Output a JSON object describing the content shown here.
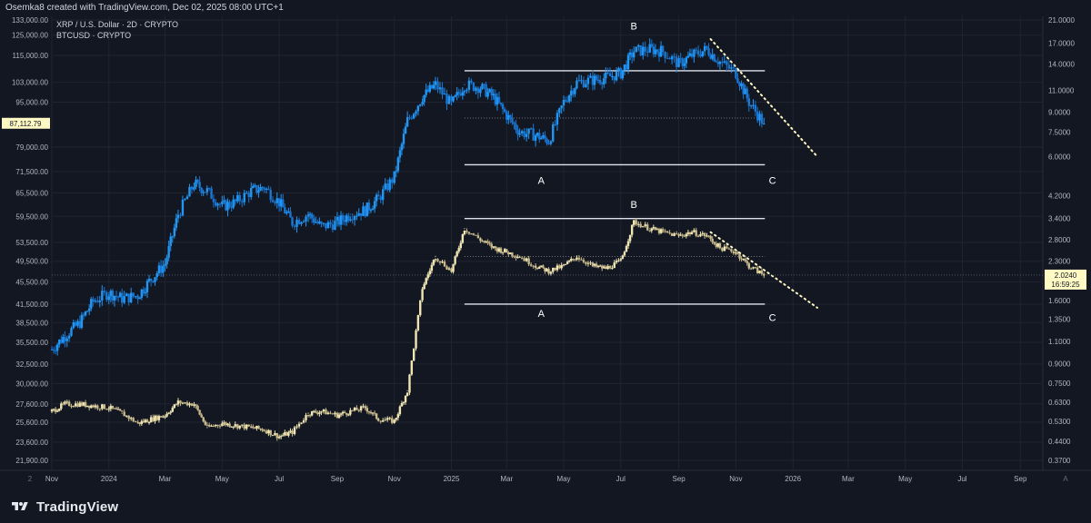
{
  "header": {
    "credit": "Osemka8 created with TradingView.com, Dec 02, 2025 08:00 UTC+1"
  },
  "footer": {
    "brand": "TradingView",
    "logo_icon": "tradingview-logo-icon"
  },
  "colors": {
    "background": "#131722",
    "btc": "#2196f3",
    "xrp": "#f0e6b4",
    "marker": "#fff9c4",
    "grid": "#1f2430"
  },
  "chart_data": {
    "type": "line",
    "legend": [
      "XRP / U.S. Dollar · 2D · CRYPTO",
      "BTCUSD · CRYPTO"
    ],
    "x_tick_labels": [
      "Nov",
      "2024",
      "Mar",
      "May",
      "Jul",
      "Sep",
      "Nov",
      "2025",
      "Mar",
      "May",
      "Jul",
      "Sep",
      "Nov",
      "2026",
      "Mar",
      "May",
      "Jul",
      "Sep"
    ],
    "x_ticks": [
      "2023-11",
      "2024-01",
      "2024-03",
      "2024-05",
      "2024-07",
      "2024-09",
      "2024-11",
      "2025-01",
      "2025-03",
      "2025-05",
      "2025-07",
      "2025-09",
      "2025-11",
      "2026-01",
      "2026-03",
      "2026-05",
      "2026-07",
      "2026-09"
    ],
    "x_range": [
      "2023-11-01",
      "2026-09-25"
    ],
    "axis_corner_left": "2",
    "axis_corner_right": "A",
    "left_axis": {
      "scale": "log",
      "ticks": [
        "133,000.00",
        "125,000.00",
        "115,000.00",
        "103,000.00",
        "95,000.00",
        "79,000.00",
        "71,500.00",
        "65,500.00",
        "59,500.00",
        "53,500.00",
        "49,500.00",
        "45,500.00",
        "41,500.00",
        "38,500.00",
        "35,500.00",
        "32,500.00",
        "30,000.00",
        "27,600.00",
        "25,600.00",
        "23,600.00",
        "21,900.00"
      ],
      "tick_values": [
        133000,
        125000,
        115000,
        103000,
        95000,
        79000,
        71500,
        65500,
        59500,
        53500,
        49500,
        45500,
        41500,
        38500,
        35500,
        32500,
        30000,
        27600,
        25600,
        23600,
        21900
      ],
      "last_price_label": "87,112.79",
      "last_price": 87112.79
    },
    "right_axis": {
      "scale": "log",
      "ticks": [
        "21.0000",
        "17.0000",
        "14.0000",
        "11.0000",
        "9.0000",
        "7.5000",
        "6.0000",
        "4.2000",
        "3.4000",
        "2.8000",
        "2.3000",
        "1.6000",
        "1.3500",
        "1.1000",
        "0.9000",
        "0.7500",
        "0.6300",
        "0.5300",
        "0.4400",
        "0.3700"
      ],
      "tick_values": [
        21,
        17,
        14,
        11,
        9,
        7.5,
        6,
        4.2,
        3.4,
        2.8,
        2.3,
        1.6,
        1.35,
        1.1,
        0.9,
        0.75,
        0.63,
        0.53,
        0.44,
        0.37
      ],
      "last_price_label": "2.0240",
      "countdown_label": "16:59:25",
      "last_price": 2.024
    },
    "series": [
      {
        "name": "BTCUSD",
        "axis": "left",
        "x": [
          "2023-11-01",
          "2023-11-15",
          "2023-12-01",
          "2023-12-15",
          "2024-01-01",
          "2024-01-15",
          "2024-02-01",
          "2024-02-15",
          "2024-03-01",
          "2024-03-15",
          "2024-04-01",
          "2024-04-15",
          "2024-05-01",
          "2024-05-15",
          "2024-06-01",
          "2024-06-15",
          "2024-07-01",
          "2024-07-15",
          "2024-08-01",
          "2024-08-15",
          "2024-09-01",
          "2024-09-15",
          "2024-10-01",
          "2024-10-15",
          "2024-11-01",
          "2024-11-15",
          "2024-12-01",
          "2024-12-15",
          "2025-01-01",
          "2025-01-15",
          "2025-02-01",
          "2025-02-15",
          "2025-03-01",
          "2025-03-15",
          "2025-04-01",
          "2025-04-15",
          "2025-05-01",
          "2025-05-15",
          "2025-06-01",
          "2025-06-15",
          "2025-07-01",
          "2025-07-15",
          "2025-08-01",
          "2025-08-15",
          "2025-09-01",
          "2025-09-15",
          "2025-10-01",
          "2025-10-15",
          "2025-11-01",
          "2025-11-15",
          "2025-12-01"
        ],
        "values": [
          34500,
          36500,
          38500,
          42000,
          43500,
          42500,
          43000,
          46000,
          49000,
          60000,
          68000,
          66000,
          62000,
          63000,
          66000,
          67000,
          63000,
          58000,
          60000,
          57000,
          58000,
          60000,
          61000,
          64000,
          70000,
          88000,
          97000,
          102000,
          94000,
          102000,
          101000,
          97000,
          90000,
          84000,
          83000,
          81000,
          95000,
          103000,
          104000,
          105000,
          107000,
          117000,
          118000,
          117000,
          111000,
          115000,
          118000,
          112000,
          107000,
          95000,
          87000
        ]
      },
      {
        "name": "XRPUSD",
        "axis": "right",
        "x": [
          "2023-11-01",
          "2023-11-15",
          "2023-12-01",
          "2023-12-15",
          "2024-01-01",
          "2024-01-15",
          "2024-02-01",
          "2024-02-15",
          "2024-03-01",
          "2024-03-15",
          "2024-04-01",
          "2024-04-15",
          "2024-05-01",
          "2024-05-15",
          "2024-06-01",
          "2024-06-15",
          "2024-07-01",
          "2024-07-15",
          "2024-08-01",
          "2024-08-15",
          "2024-09-01",
          "2024-09-15",
          "2024-10-01",
          "2024-10-15",
          "2024-11-01",
          "2024-11-15",
          "2024-12-01",
          "2024-12-15",
          "2025-01-01",
          "2025-01-15",
          "2025-02-01",
          "2025-02-15",
          "2025-03-01",
          "2025-03-15",
          "2025-04-01",
          "2025-04-15",
          "2025-05-01",
          "2025-05-15",
          "2025-06-01",
          "2025-06-15",
          "2025-07-01",
          "2025-07-15",
          "2025-08-01",
          "2025-08-15",
          "2025-09-01",
          "2025-09-15",
          "2025-10-01",
          "2025-10-15",
          "2025-11-01",
          "2025-11-15",
          "2025-12-01"
        ],
        "values": [
          0.58,
          0.62,
          0.62,
          0.61,
          0.6,
          0.57,
          0.52,
          0.54,
          0.56,
          0.63,
          0.62,
          0.5,
          0.52,
          0.51,
          0.5,
          0.49,
          0.46,
          0.48,
          0.57,
          0.58,
          0.56,
          0.58,
          0.6,
          0.54,
          0.53,
          0.7,
          1.8,
          2.4,
          2.1,
          3.1,
          2.8,
          2.6,
          2.5,
          2.4,
          2.2,
          2.1,
          2.2,
          2.4,
          2.2,
          2.15,
          2.3,
          3.3,
          3.1,
          3.0,
          2.9,
          3.0,
          2.9,
          2.6,
          2.5,
          2.2,
          2.02
        ]
      }
    ],
    "annotations": {
      "btc": {
        "range_top": 108000,
        "range_mid": 89000,
        "range_bottom": 73500,
        "range_start": "2025-01-15",
        "range_end": "2025-12-02",
        "labels": [
          {
            "text": "B",
            "x": "2025-07-15",
            "y": 128000
          },
          {
            "text": "A",
            "x": "2025-04-07",
            "y": 68000
          },
          {
            "text": "C",
            "x": "2025-12-10",
            "y": 68000
          }
        ],
        "trendline": {
          "from": {
            "x": "2025-10-05",
            "y": 123000
          },
          "to": {
            "x": "2026-01-27",
            "y": 76000
          }
        }
      },
      "xrp": {
        "range_top": 3.4,
        "range_mid": 2.4,
        "range_bottom": 1.55,
        "range_start": "2025-01-15",
        "range_end": "2025-12-02",
        "labels": [
          {
            "text": "B",
            "x": "2025-07-15",
            "y": 3.75
          },
          {
            "text": "A",
            "x": "2025-04-07",
            "y": 1.38
          },
          {
            "text": "C",
            "x": "2025-12-10",
            "y": 1.33
          }
        ],
        "trendline": {
          "from": {
            "x": "2025-10-05",
            "y": 3.0
          },
          "to": {
            "x": "2026-01-27",
            "y": 1.5
          }
        }
      }
    }
  }
}
